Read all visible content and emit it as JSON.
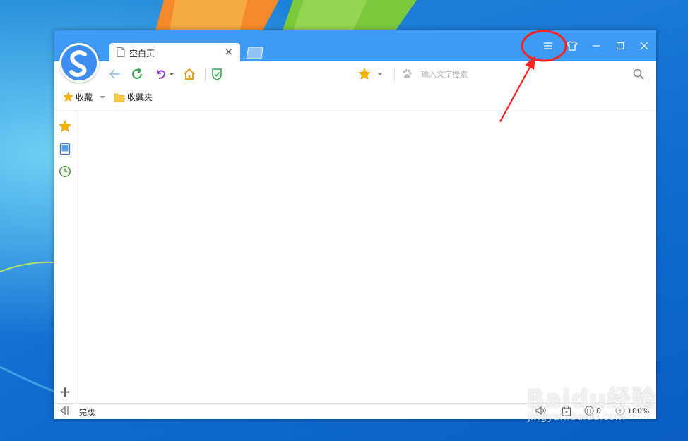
{
  "browser": {
    "tab": {
      "title": "空白页",
      "close_glyph": "×"
    },
    "window_controls": [
      "menu-icon",
      "skin-icon",
      "minimize-icon",
      "maximize-icon",
      "close-icon"
    ],
    "search": {
      "placeholder": "输入文字搜索",
      "value": ""
    },
    "bookmarks_bar": {
      "favorites_label": "收藏",
      "folder_label": "收藏夹"
    },
    "sidebar": {
      "icons": [
        "star-icon",
        "tablet-icon",
        "history-clock-icon"
      ],
      "add_glyph": "+"
    },
    "status": {
      "text": "完成",
      "download_count": "0",
      "zoom": "100%"
    }
  },
  "watermark": {
    "text": "Baidu经验",
    "url": "jingyan.baidu.com"
  },
  "colors": {
    "titlebar": "#3d9af5",
    "annotation": "#ff2222",
    "accent_star": "#f4b400"
  }
}
